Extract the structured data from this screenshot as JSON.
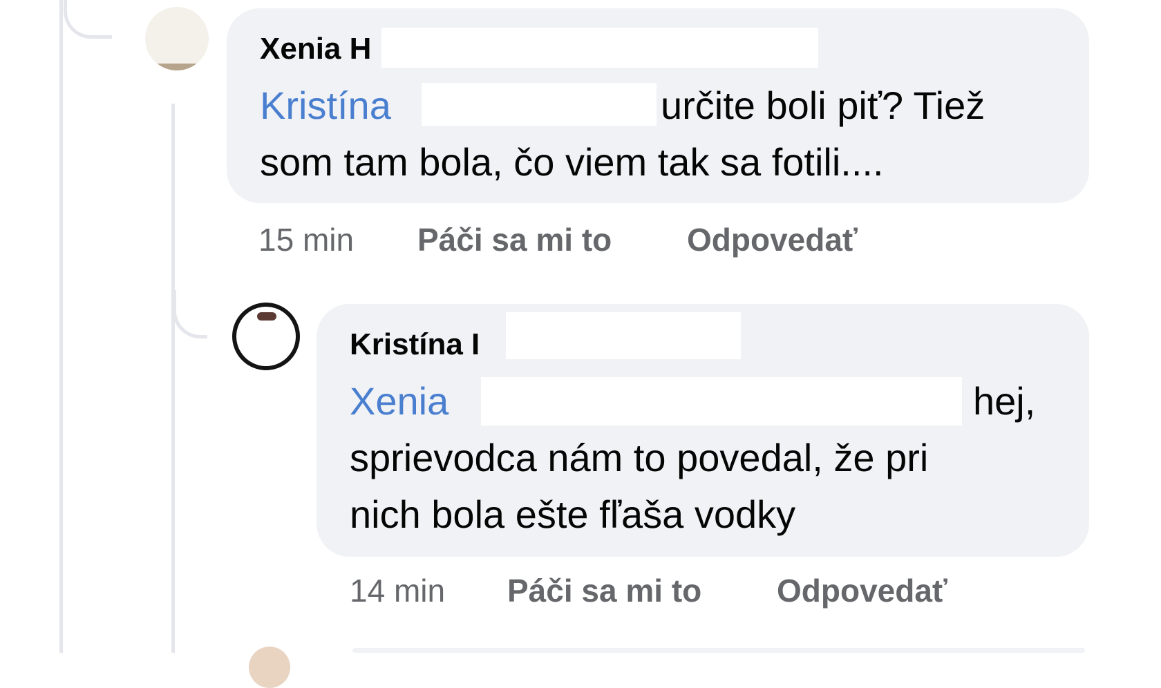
{
  "comments": [
    {
      "author": "Xenia H",
      "mention": "Kristína",
      "line1_rest": "určite boli piť? Tiež",
      "line2": "som tam bola, čo viem tak sa fotili....",
      "time": "15 min",
      "like_label": "Páči sa mi to",
      "reply_label": "Odpovedať"
    },
    {
      "author": "Kristína I",
      "mention": "Xenia",
      "line1_rest": "hej,",
      "line2": "sprievodca nám to povedal, že pri",
      "line3": "nich bola ešte fľaša vodky",
      "time": "14 min",
      "like_label": "Páči sa mi to",
      "reply_label": "Odpovedať"
    }
  ],
  "colors": {
    "bubble_bg": "#f0f2f5",
    "mention": "#4a7fd0",
    "meta": "#65676b",
    "thread_line": "#e4e6eb"
  }
}
